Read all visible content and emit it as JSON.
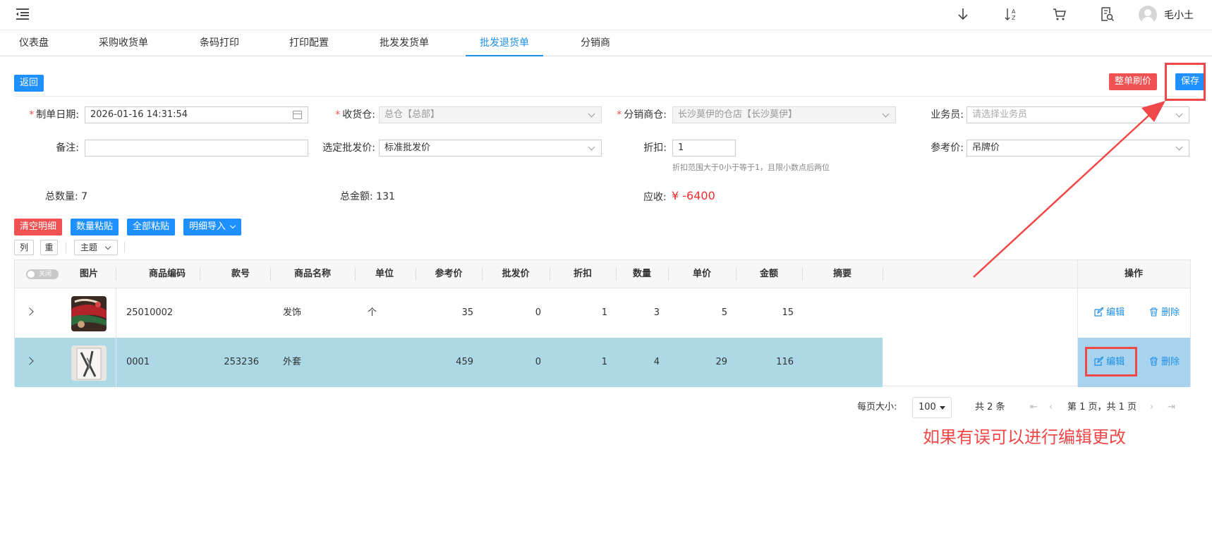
{
  "header": {
    "user_name": "毛小土",
    "tools": [
      "download-icon",
      "sort-az-icon",
      "cart-icon",
      "report-search-icon"
    ]
  },
  "tabs": [
    {
      "label": "仪表盘",
      "active": false
    },
    {
      "label": "采购收货单",
      "active": false
    },
    {
      "label": "条码打印",
      "active": false
    },
    {
      "label": "打印配置",
      "active": false
    },
    {
      "label": "批发发货单",
      "active": false
    },
    {
      "label": "批发退货单",
      "active": true
    },
    {
      "label": "分销商",
      "active": false
    }
  ],
  "actions": {
    "back_label": "返回",
    "reprice_label": "整单刷价",
    "save_label": "保存"
  },
  "form": {
    "date_label": "制单日期:",
    "date_value": "2026-01-16 14:31:54",
    "warehouse_label": "收货仓:",
    "warehouse_value": "总仓【总部】",
    "distributor_label": "分销商仓:",
    "distributor_value": "长沙莫伊的仓店【长沙莫伊】",
    "salesperson_label": "业务员:",
    "salesperson_placeholder": "请选择业务员",
    "remark_label": "备注:",
    "remark_value": "",
    "price_type_label": "选定批发价:",
    "price_type_value": "标准批发价",
    "discount_label": "折扣:",
    "discount_value": "1",
    "discount_hint": "折扣范围大于0小于等于1，且限小数点后两位",
    "ref_price_label": "参考价:",
    "ref_price_value": "吊牌价"
  },
  "summary": {
    "total_qty_label": "总数量:",
    "total_qty": "7",
    "total_amount_label": "总金额:",
    "total_amount": "131",
    "receivable_label": "应收:",
    "receivable": "¥ -6400"
  },
  "detail_buttons": {
    "clear": "清空明细",
    "qty_paste": "数量粘贴",
    "all_paste": "全部粘贴",
    "import": "明细导入"
  },
  "table_tools": {
    "columns": "列",
    "reset": "重",
    "theme": "主题"
  },
  "table": {
    "toggle_label": "关闭",
    "headers": [
      "图片",
      "商品编码",
      "款号",
      "商品名称",
      "单位",
      "参考价",
      "批发价",
      "折扣",
      "数量",
      "单价",
      "金额",
      "摘要",
      "操作"
    ],
    "rows": [
      {
        "code": "25010002",
        "style": "",
        "name": "发饰",
        "unit": "个",
        "ref_price": "35",
        "wholesale": "0",
        "discount": "1",
        "qty": "3",
        "unit_price": "5",
        "amount": "15",
        "memo": "",
        "edit": "编辑",
        "delete": "删除"
      },
      {
        "code": "0001",
        "style": "253236",
        "name": "外套",
        "unit": "",
        "ref_price": "459",
        "wholesale": "0",
        "discount": "1",
        "qty": "4",
        "unit_price": "29",
        "amount": "116",
        "memo": "",
        "edit": "编辑",
        "delete": "删除"
      }
    ]
  },
  "pagination": {
    "page_size_label": "每页大小:",
    "page_size": "100",
    "total": "共 2 条",
    "page_info": "第 1 页，共 1 页"
  },
  "annotation": {
    "text": "如果有误可以进行编辑更改",
    "color": "#f04848"
  },
  "colors": {
    "accent": "#1e90ff",
    "danger": "#f05252",
    "selected_row": "#add8e6"
  }
}
